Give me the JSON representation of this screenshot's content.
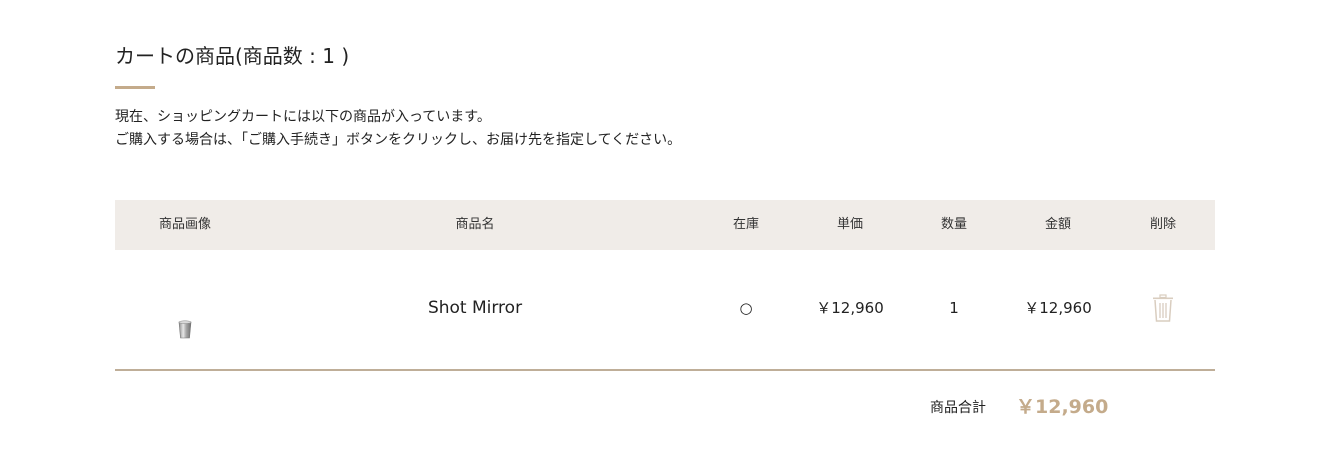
{
  "cart": {
    "title": "カートの商品(商品数 : 1 )",
    "description_line1": "現在、ショッピングカートには以下の商品が入っています。",
    "description_line2": "ご購入する場合は、「ご購入手続き」ボタンをクリックし、お届け先を指定してください。"
  },
  "table": {
    "headers": {
      "image": "商品画像",
      "name": "商品名",
      "stock": "在庫",
      "unit_price": "単価",
      "quantity": "数量",
      "amount": "金額",
      "delete": "削除"
    },
    "rows": [
      {
        "image_icon": "cup-icon",
        "name": "Shot Mirror",
        "stock": "○",
        "unit_price": "￥12,960",
        "quantity": "1",
        "amount": "￥12,960",
        "delete_icon": "trash-icon"
      }
    ]
  },
  "summary": {
    "label": "商品合計",
    "total": "￥12,960"
  },
  "colors": {
    "accent": "#c4ab8b",
    "header_bg": "#f0ece8",
    "rule": "#bfae98"
  }
}
